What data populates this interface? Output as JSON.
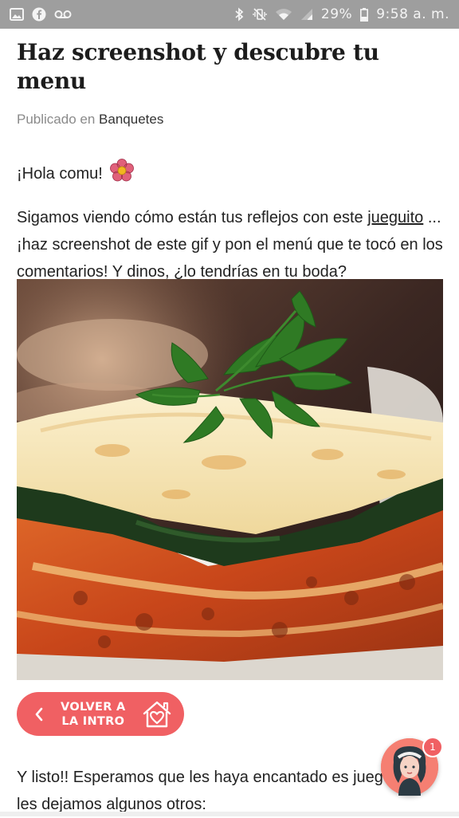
{
  "status_bar": {
    "battery": "29%",
    "time": "9:58 a. m."
  },
  "article": {
    "title": "Haz screenshot y descubre tu menu",
    "published_prefix": "Publicado en",
    "category": "Banquetes",
    "greeting": "¡Hola comu!",
    "para1_before_link": "Sigamos viendo cómo están tus reflejos con este ",
    "para1_link": "jueguito",
    "para1_after_link": " ... ¡haz screenshot de este gif y pon el menú que te tocó en los comentarios! Y dinos, ¿lo tendrías en tu boda?",
    "back_button_label": "VOLVER A\nLA INTRO",
    "para2": "Y listo!! Esperamos que les haya encantado es jueguito... les dejamos algunos otros:"
  },
  "chat": {
    "badge_count": "1"
  },
  "icons": {
    "status_left": [
      "image-icon",
      "facebook-icon",
      "voicemail-icon"
    ],
    "status_right": [
      "bluetooth-icon",
      "vibrate-icon",
      "wifi-icon",
      "signal-icon",
      "battery-icon"
    ],
    "greeting_emoji": "flower-icon",
    "back_chevron": "chevron-left-icon",
    "home_heart": "home-heart-icon"
  },
  "colors": {
    "status_bar": "#9e9e9e",
    "accent": "#f06063"
  }
}
